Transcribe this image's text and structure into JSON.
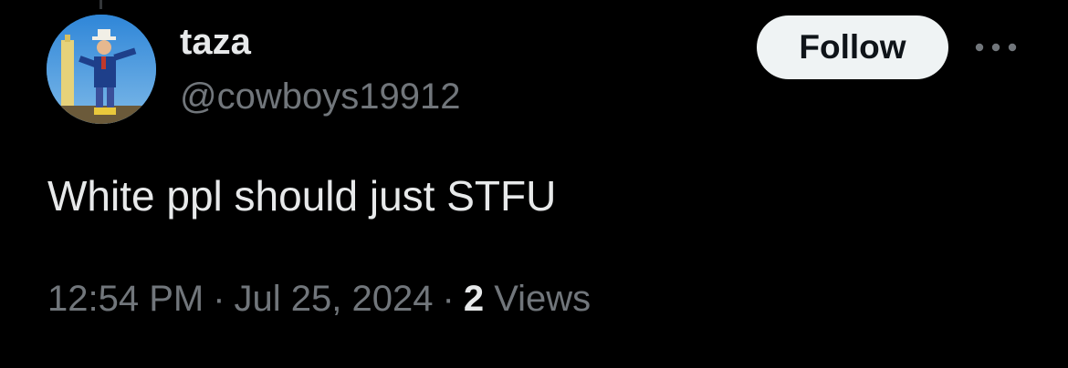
{
  "tweet": {
    "author": {
      "display_name": "taza",
      "handle": "@cowboys19912",
      "avatar_icon": "avatar-image"
    },
    "follow_label": "Follow",
    "more_icon": "more-options-icon",
    "text": "White ppl should just STFU",
    "time": "12:54 PM",
    "separator": "·",
    "date": "Jul 25, 2024",
    "views_count": "2",
    "views_label": "Views"
  },
  "colors": {
    "background": "#000000",
    "primary_text": "#e7e9ea",
    "secondary_text": "#71767b",
    "follow_bg": "#eff3f4",
    "follow_text": "#0f1419"
  }
}
